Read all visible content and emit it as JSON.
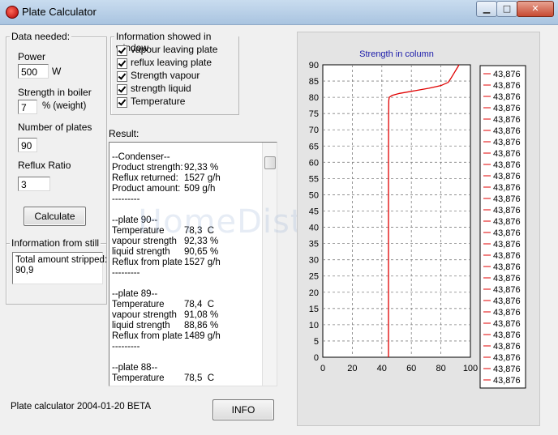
{
  "window": {
    "title": "Plate Calculator",
    "min_glyph": "▁",
    "max_glyph": "□",
    "close_glyph": "✕"
  },
  "data_needed": {
    "title": "Data needed:",
    "power_label": "Power",
    "power_value": "500",
    "power_unit": "W",
    "strength_label": "Strength in  boiler",
    "strength_value": "7",
    "strength_unit": "% (weight)",
    "plates_label": "Number of plates",
    "plates_value": "90",
    "reflux_label": "Reflux Ratio",
    "reflux_value": "3",
    "calculate_label": "Calculate"
  },
  "info_window": {
    "title": "Information showed in window",
    "options": [
      {
        "label": "vapour leaving plate",
        "checked": true
      },
      {
        "label": "reflux leaving plate",
        "checked": true
      },
      {
        "label": "Strength vapour",
        "checked": true
      },
      {
        "label": "strength liquid",
        "checked": true
      },
      {
        "label": "Temperature",
        "checked": true
      }
    ]
  },
  "still_info": {
    "title": "Information from still",
    "line1": "Total amount stripped:",
    "line2": "90,9"
  },
  "result": {
    "label": "Result:",
    "lines": [
      {
        "l": "--Condenser--",
        "v": ""
      },
      {
        "l": "Product strength:",
        "v": "92,33 %"
      },
      {
        "l": "Reflux returned:",
        "v": "1527 g/h"
      },
      {
        "l": "Product amount:",
        "v": "509 g/h"
      },
      {
        "l": "---------",
        "v": ""
      },
      {
        "l": "",
        "v": ""
      },
      {
        "l": "--plate 90--",
        "v": ""
      },
      {
        "l": "Temperature",
        "v": "78,3  C"
      },
      {
        "l": "vapour strength",
        "v": "92,33 %"
      },
      {
        "l": "liquid strength",
        "v": "90,65 %"
      },
      {
        "l": "Reflux from plate",
        "v": "1527 g/h"
      },
      {
        "l": "---------",
        "v": ""
      },
      {
        "l": "",
        "v": ""
      },
      {
        "l": "--plate 89--",
        "v": ""
      },
      {
        "l": "Temperature",
        "v": "78,4  C"
      },
      {
        "l": "vapour strength",
        "v": "91,08 %"
      },
      {
        "l": "liquid strength",
        "v": "88,86 %"
      },
      {
        "l": "Reflux from plate",
        "v": "1489 g/h"
      },
      {
        "l": "---------",
        "v": ""
      },
      {
        "l": "",
        "v": ""
      },
      {
        "l": "--plate 88--",
        "v": ""
      },
      {
        "l": "Temperature",
        "v": "78,5  C"
      }
    ]
  },
  "footer": {
    "version_text": "Plate calculator 2004-01-20 BETA",
    "info_label": "INFO"
  },
  "watermark": "HomeDistiller.ru",
  "chart_data": {
    "type": "line",
    "title": "Strength in column",
    "title_color": "#1a1aaa",
    "line_color": "#e00000",
    "xlim": [
      0,
      100
    ],
    "ylim": [
      0,
      90
    ],
    "x_ticks": [
      "0",
      "20",
      "40",
      "60",
      "80",
      "100"
    ],
    "y_ticks": [
      "0",
      "5",
      "10",
      "15",
      "20",
      "25",
      "30",
      "35",
      "40",
      "45",
      "50",
      "55",
      "60",
      "65",
      "70",
      "75",
      "80",
      "85",
      "90"
    ],
    "grid": true,
    "legend_position": "right",
    "legend_entries": [
      "43,876",
      "43,876",
      "43,876",
      "43,876",
      "43,876",
      "43,876",
      "43,876",
      "43,876",
      "43,876",
      "43,876",
      "43,876",
      "43,876",
      "43,876",
      "43,876",
      "43,876",
      "43,876",
      "43,876",
      "43,876",
      "43,876",
      "43,876",
      "43,876",
      "43,876",
      "43,876",
      "43,876",
      "43,876",
      "43,876",
      "43,876",
      "43,876"
    ],
    "series": [
      {
        "x": [
          44.5,
          44.5,
          44.5,
          44.5,
          44.6,
          44.7,
          45,
          47,
          52,
          62,
          72,
          80,
          85,
          87,
          89,
          91,
          92.3
        ],
        "y": [
          0,
          20,
          40,
          60,
          75,
          79,
          80,
          80.6,
          81.2,
          82,
          82.8,
          83.6,
          84.6,
          86,
          87.5,
          89,
          90
        ]
      }
    ]
  }
}
